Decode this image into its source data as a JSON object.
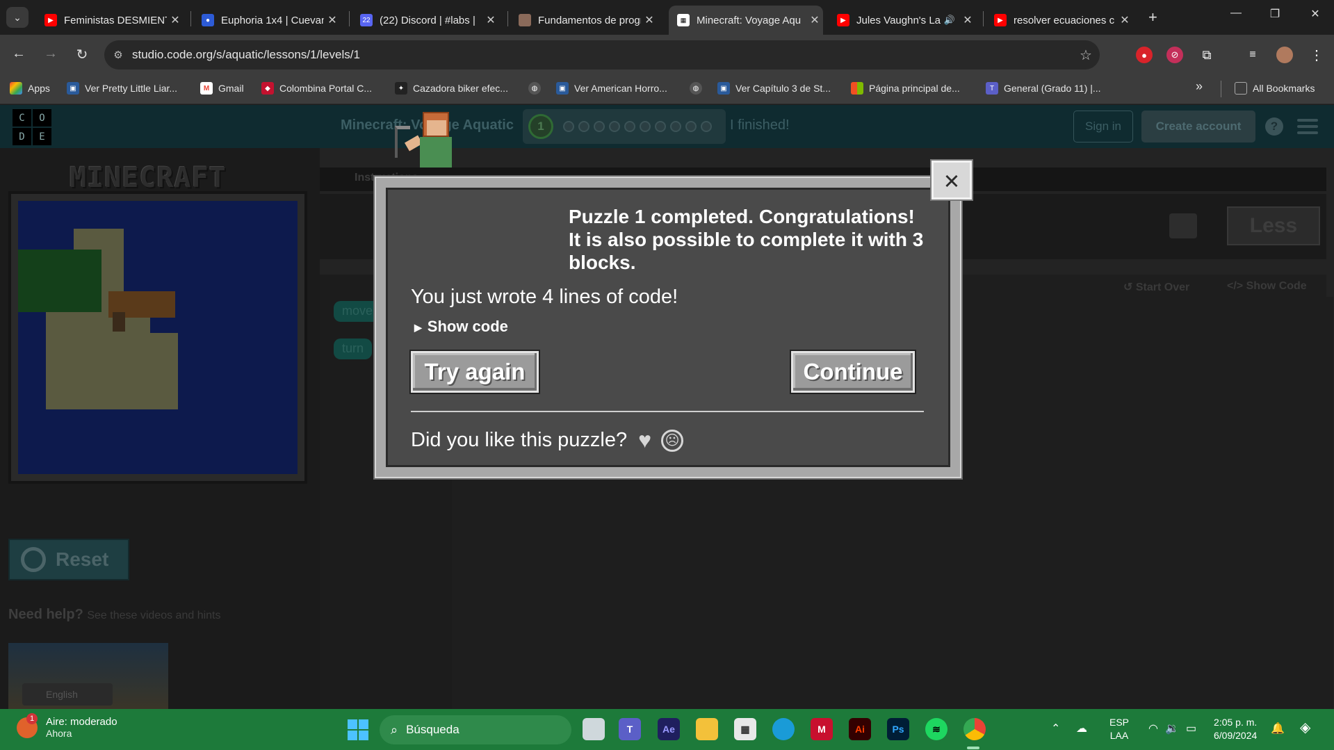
{
  "browser": {
    "tabs": [
      {
        "title": "Feministas DESMIENTEN",
        "favicon": "youtube-icon",
        "color": "#ff0000"
      },
      {
        "title": "Euphoria 1x4 | Cuevana",
        "favicon": "cuevana-icon",
        "color": "#2d5bd6"
      },
      {
        "title": "(22) Discord | #labs |",
        "favicon": "discord-icon",
        "color": "#5865f2",
        "badge": "22"
      },
      {
        "title": "Fundamentos de progr",
        "favicon": "avatar-icon",
        "color": "#8a6a5a"
      },
      {
        "title": "Minecraft: Voyage Aqu",
        "favicon": "codeorg-icon",
        "color": "#ffffff",
        "active": true
      },
      {
        "title": "Jules Vaughn's La",
        "favicon": "youtube-icon",
        "color": "#ff0000",
        "audio": "🔊"
      },
      {
        "title": "resolver ecuaciones c",
        "favicon": "youtube-icon",
        "color": "#ff0000"
      }
    ],
    "url": "studio.code.org/s/aquatic/lessons/1/levels/1",
    "bookmarks": [
      {
        "label": "Apps",
        "icon": "apps-grid-icon"
      },
      {
        "label": "Ver Pretty Little Liar...",
        "icon": "film-icon"
      },
      {
        "label": "Gmail",
        "icon": "gmail-icon"
      },
      {
        "label": "Colombina Portal C...",
        "icon": "colombina-icon"
      },
      {
        "label": "Cazadora biker efec...",
        "icon": "shop-icon"
      },
      {
        "label": "",
        "icon": "globe-icon"
      },
      {
        "label": "Ver American Horro...",
        "icon": "film-icon"
      },
      {
        "label": "",
        "icon": "globe-icon"
      },
      {
        "label": "Ver Capítulo 3 de St...",
        "icon": "film-icon"
      },
      {
        "label": "Página principal de...",
        "icon": "microsoft-icon"
      },
      {
        "label": "General (Grado 11) |...",
        "icon": "teams-icon"
      }
    ],
    "bookmarks_more": "»",
    "all_bookmarks": "All Bookmarks"
  },
  "header": {
    "logo_letters": [
      "C",
      "O",
      "D",
      "E"
    ],
    "lesson_title": "Minecraft: Voyage Aquatic",
    "level_number": "1",
    "finished": "I finished!",
    "sign_in": "Sign in",
    "create_account": "Create account",
    "help": "?"
  },
  "game": {
    "logo": "MINECRAFT",
    "reset": "Reset",
    "need_help": "Need help?",
    "need_help_sub": "See these videos and hints",
    "language": "English"
  },
  "workspace": {
    "instructions_tab": "Instructions",
    "less": "Less",
    "start_over": "Start Over",
    "show_code": "Show Code",
    "blocks": [
      "move",
      "turn"
    ]
  },
  "dialog": {
    "title": "Puzzle 1 completed. Congratulations! It is also possible to complete it with 3 blocks.",
    "lines_msg": "You just wrote 4 lines of code!",
    "show_code": "Show code",
    "try_again": "Try again",
    "continue": "Continue",
    "feedback": "Did you like this puzzle?"
  },
  "taskbar": {
    "weather_title": "Aire: moderado",
    "weather_sub": "Ahora",
    "weather_badge": "1",
    "search": "Búsqueda",
    "lang1": "ESP",
    "lang2": "LAA",
    "time": "2:05 p. m.",
    "date": "6/09/2024"
  }
}
